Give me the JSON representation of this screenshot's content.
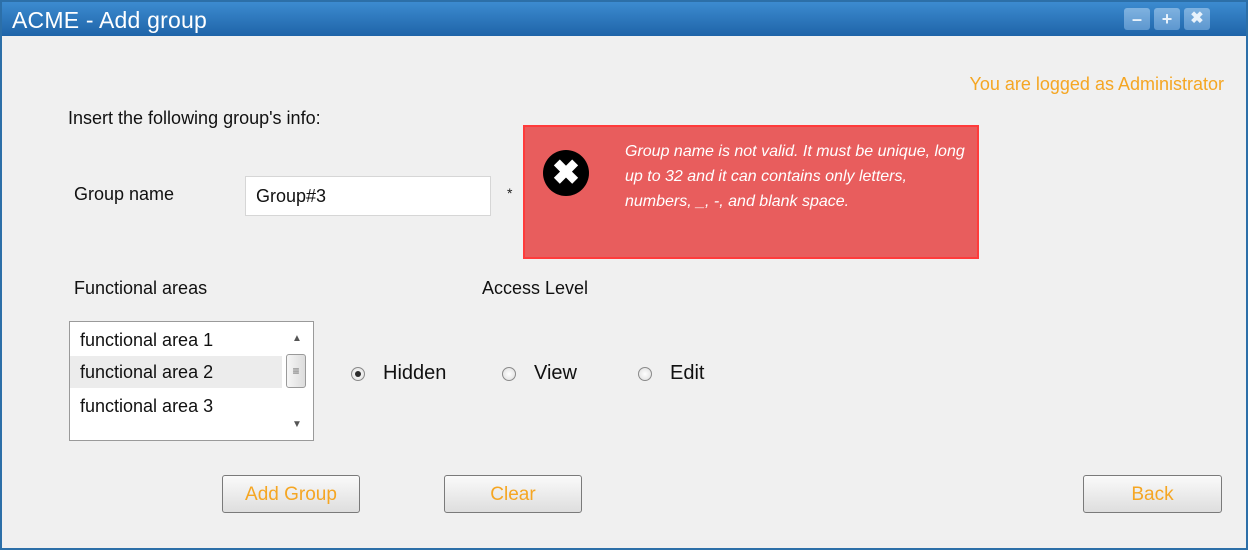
{
  "window": {
    "title": "ACME - Add group",
    "controls": {
      "minimize": "–",
      "maximize": "+",
      "close": "✖"
    }
  },
  "header": {
    "logged_as": "You are logged as Administrator"
  },
  "form": {
    "instructions": "Insert the following group's info:",
    "group_name_label": "Group name",
    "group_name_value": "Group#3",
    "required_marker": "*",
    "functional_areas_label": "Functional areas",
    "functional_areas": [
      "functional area 1",
      "functional area 2",
      "functional area 3"
    ],
    "access_level_label": "Access Level",
    "access_levels": [
      "Hidden",
      "View",
      "Edit"
    ],
    "selected_access_level": "Hidden"
  },
  "error": {
    "message": "Group name is not valid. It must be unique, long up to 32 and it can contains only letters, numbers, _, -, and blank space.",
    "icon": "close-icon"
  },
  "buttons": {
    "add_group": "Add Group",
    "clear": "Clear",
    "back": "Back"
  },
  "colors": {
    "accent": "#f5a623",
    "titlebar": "#2c6fa8",
    "error_bg": "#e85d5d",
    "error_border": "#ff3b3b"
  }
}
